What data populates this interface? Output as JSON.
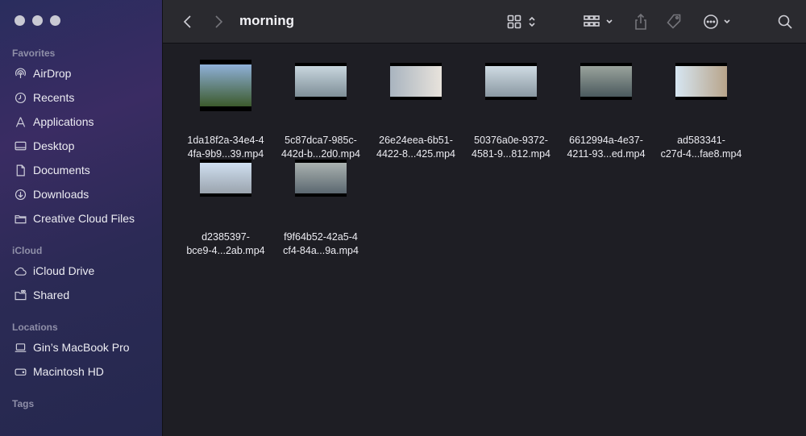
{
  "sidebar": {
    "favorites_title": "Favorites",
    "favorites": [
      {
        "label": "AirDrop",
        "icon": "airdrop-icon"
      },
      {
        "label": "Recents",
        "icon": "clock-icon"
      },
      {
        "label": "Applications",
        "icon": "applications-icon"
      },
      {
        "label": "Desktop",
        "icon": "desktop-icon"
      },
      {
        "label": "Documents",
        "icon": "document-icon"
      },
      {
        "label": "Downloads",
        "icon": "download-icon"
      },
      {
        "label": "Creative Cloud Files",
        "icon": "folder-icon"
      }
    ],
    "icloud_title": "iCloud",
    "icloud": [
      {
        "label": "iCloud Drive",
        "icon": "cloud-icon"
      },
      {
        "label": "Shared",
        "icon": "shared-folder-icon"
      }
    ],
    "locations_title": "Locations",
    "locations": [
      {
        "label": "Gin’s MacBook Pro",
        "icon": "laptop-icon"
      },
      {
        "label": "Macintosh HD",
        "icon": "disk-icon"
      }
    ],
    "tags_title": "Tags"
  },
  "toolbar": {
    "title": "morning"
  },
  "files": [
    {
      "line1": "1da18f2a-34e4-4",
      "line2": "4fa-9b9...39.mp4",
      "thumb_colors": [
        "#8fb0d8",
        "#3c5a2c"
      ]
    },
    {
      "line1": "5c87dca7-985c-",
      "line2": "442d-b...2d0.mp4",
      "thumb_colors": [
        "#c8d6de",
        "#7f8f98"
      ]
    },
    {
      "line1": "26e24eea-6b51-",
      "line2": "4422-8...425.mp4",
      "thumb_colors": [
        "#a9b4bf",
        "#e8e3dc"
      ]
    },
    {
      "line1": "50376a0e-9372-",
      "line2": "4581-9...812.mp4",
      "thumb_colors": [
        "#cfdbe3",
        "#8a98a2"
      ]
    },
    {
      "line1": "6612994a-4e37-",
      "line2": "4211-93...ed.mp4",
      "thumb_colors": [
        "#9aa39c",
        "#4b5a5e"
      ]
    },
    {
      "line1": "ad583341-",
      "line2": "c27d-4...fae8.mp4",
      "thumb_colors": [
        "#d6e6f2",
        "#b8a48a"
      ]
    },
    {
      "line1": "d2385397-",
      "line2": "bce9-4...2ab.mp4",
      "thumb_colors": [
        "#cfdff0",
        "#9aa3ad"
      ]
    },
    {
      "line1": "f9f64b52-42a5-4",
      "line2": "cf4-84a...9a.mp4",
      "thumb_colors": [
        "#aab2b0",
        "#5b6770"
      ]
    }
  ]
}
